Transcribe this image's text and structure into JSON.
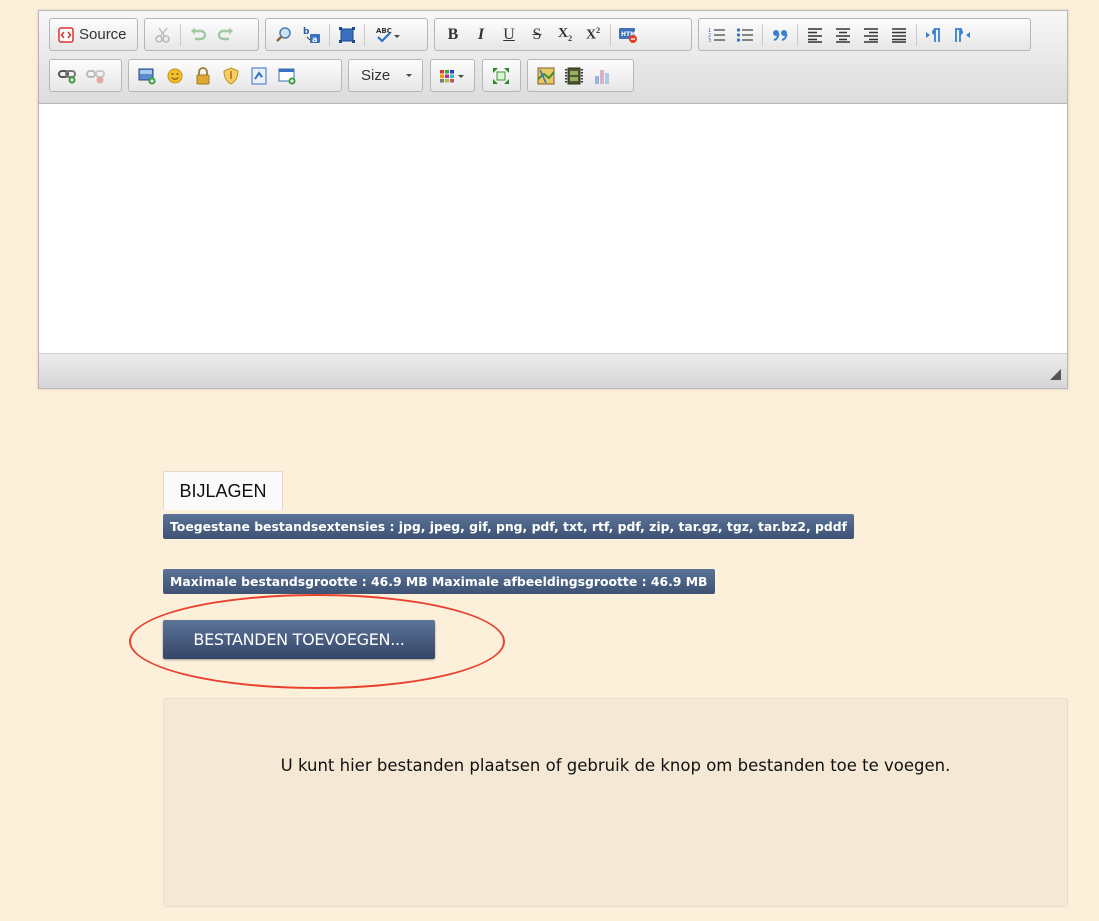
{
  "toolbar": {
    "source_label": "Source",
    "size_label": "Size",
    "row1": [
      {
        "icon": "source-icon",
        "label_key": "source_label"
      },
      {
        "icon": "cut-icon"
      },
      {
        "icon": "undo-icon"
      },
      {
        "icon": "redo-icon"
      },
      {
        "icon": "find-icon"
      },
      {
        "icon": "replace-icon"
      },
      {
        "icon": "select-all-icon"
      },
      {
        "icon": "spellcheck-icon"
      },
      {
        "icon": "bold-icon",
        "glyph": "B"
      },
      {
        "icon": "italic-icon",
        "glyph": "I"
      },
      {
        "icon": "underline-icon",
        "glyph": "U"
      },
      {
        "icon": "strikethrough-icon",
        "glyph": "S"
      },
      {
        "icon": "subscript-icon",
        "glyph": "X₂"
      },
      {
        "icon": "superscript-icon",
        "glyph": "X²"
      },
      {
        "icon": "remove-format-icon"
      },
      {
        "icon": "numbered-list-icon"
      },
      {
        "icon": "bulleted-list-icon"
      },
      {
        "icon": "blockquote-icon"
      },
      {
        "icon": "align-left-icon"
      },
      {
        "icon": "align-center-icon"
      },
      {
        "icon": "align-right-icon"
      },
      {
        "icon": "justify-icon"
      },
      {
        "icon": "ltr-icon"
      },
      {
        "icon": "rtl-icon"
      }
    ],
    "row2": [
      {
        "icon": "link-icon"
      },
      {
        "icon": "unlink-icon"
      },
      {
        "icon": "image-icon"
      },
      {
        "icon": "smiley-icon"
      },
      {
        "icon": "lock-icon"
      },
      {
        "icon": "shield-icon"
      },
      {
        "icon": "template-icon"
      },
      {
        "icon": "iframe-icon"
      },
      {
        "icon": "text-color-icon"
      },
      {
        "icon": "maximize-icon"
      },
      {
        "icon": "map-icon"
      },
      {
        "icon": "video-icon"
      },
      {
        "icon": "chart-icon"
      }
    ]
  },
  "attachments": {
    "tab_label": "BIJLAGEN",
    "allowed_extensions": "Toegestane bestandsextensies : jpg, jpeg, gif, png, pdf, txt, rtf, pdf, zip, tar.gz, tgz, tar.bz2, pddf",
    "max_sizes": "Maximale bestandsgrootte : 46.9 MB Maximale afbeeldingsgrootte : 46.9 MB",
    "add_button": "BESTANDEN TOEVOEGEN...",
    "dropzone_text": "U kunt hier bestanden plaatsen of gebruik de knop om bestanden toe te voegen."
  },
  "colors": {
    "page_bg": "#fdf0da",
    "badge_blue": "#4a5f82",
    "highlight_red": "#e8412e"
  }
}
